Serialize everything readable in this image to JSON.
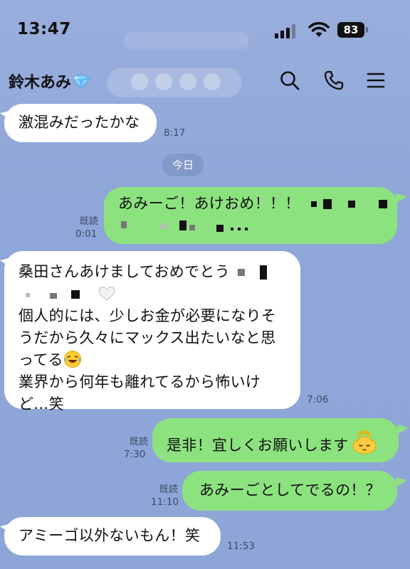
{
  "status_bar": {
    "time": "13:47",
    "battery": "83"
  },
  "header": {
    "contact_name": "鈴木あみ",
    "name_icon": "diamond-icon",
    "actions": [
      "search-icon",
      "phone-icon",
      "menu-icon"
    ]
  },
  "date_separator": "今日",
  "messages": {
    "m1": {
      "text": "激混みだったかな",
      "time": "8:17"
    },
    "m2": {
      "line1": "あみーご！あけおめ！！！",
      "read": "既読",
      "time": "0:01"
    },
    "m3": {
      "line1": "桑田さんあけましておめでとう",
      "line2": "個人的には、少しお金が必要になりそ",
      "line3": "うだから久々にマックス出たいなと思",
      "line4": "ってる",
      "line5": "業界から何年も離れてるから怖いけ",
      "line6": "ど…笑",
      "time": "7:06"
    },
    "m4": {
      "text": "是非！宜しくお願いします",
      "read": "既読",
      "time": "7:30"
    },
    "m5": {
      "text": "あみーごとしてでるの！？",
      "read": "既読",
      "time": "11:10"
    },
    "m6": {
      "text": "アミーゴ以外ないもん！笑",
      "time": "11:53"
    }
  },
  "colors": {
    "background": "#8ea7d8",
    "incoming_bubble": "#ffffff",
    "outgoing_bubble": "#8de280"
  }
}
